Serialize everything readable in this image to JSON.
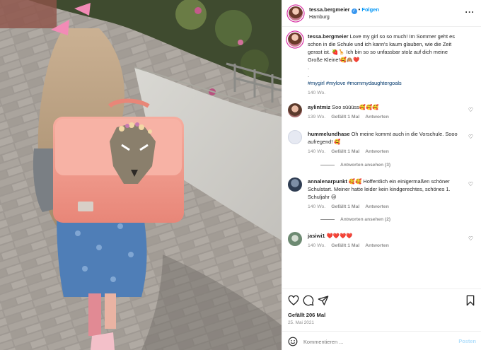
{
  "photo": {
    "description_icon": "photo-girl-pink-backpack"
  },
  "header": {
    "username": "tessa.bergmeier",
    "verified_icon": "verified-badge-icon",
    "separator": "•",
    "follow": "Folgen",
    "location": "Hamburg",
    "more_icon": "more-options-icon",
    "more": "···"
  },
  "caption": {
    "username": "tessa.bergmeier",
    "text": "Love my girl so so much! Im Sommer geht es schon in die Schule und ich kann's kaum glauben, wie die Zeit gerast ist. 🍓🦒 Ich bin so so unfassbar stolz auf dich meine Große Kleine!🥰🙈❤️",
    "dot1": ".",
    "dot2": ".",
    "hashtags": "#mygirl #mylove #mommydaughtergoals",
    "time": "140 Wo."
  },
  "comments": [
    {
      "username": "aylintmiz",
      "text": "Soo süüüss🥰🥰🥰",
      "time": "139 Wo.",
      "likes": "Gefällt 1 Mal",
      "reply": "Antworten"
    },
    {
      "username": "hummelundhase",
      "text": "Oh meine kommt auch in die Vorschule. Sooo aufregend! 🥰",
      "time": "140 Wo.",
      "likes": "Gefällt 1 Mal",
      "reply": "Antworten",
      "view_replies": "Antworten ansehen (3)"
    },
    {
      "username": "annalenarpunkt",
      "text": "🥰🥰 Hoffentlich ein einigermaßen schöner Schulstart. Meiner hatte leider kein kindgerechtes, schönes 1. Schuljahr 😢",
      "time": "140 Wo.",
      "likes": "Gefällt 1 Mal",
      "reply": "Antworten",
      "view_replies": "Antworten ansehen (2)"
    },
    {
      "username": "jasiwi1",
      "text": "❤️❤️❤️❤️",
      "time": "140 Wo.",
      "likes": "Gefällt 1 Mal",
      "reply": "Antworten"
    }
  ],
  "actions": {
    "like_icon": "heart-icon",
    "comment_icon": "comment-icon",
    "share_icon": "share-icon",
    "save_icon": "bookmark-icon",
    "likes": "Gefällt 206 Mal",
    "date": "25. Mai 2021"
  },
  "composer": {
    "emoji_icon": "emoji-icon",
    "placeholder": "Kommentieren ...",
    "post": "Posten"
  },
  "colors": {
    "accent": "#0095f6",
    "backpack": "#f19b8f",
    "heart_red": "#ed4956"
  }
}
